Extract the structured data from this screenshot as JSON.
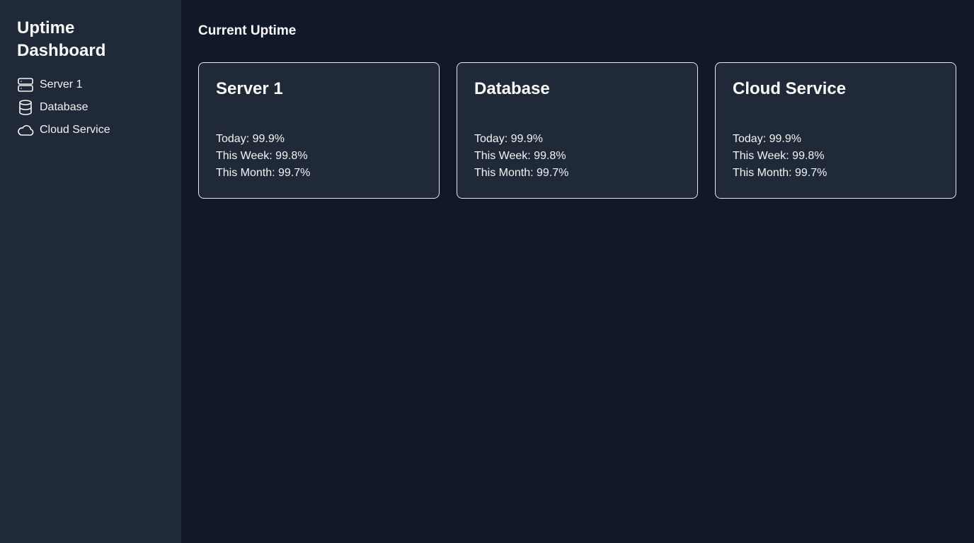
{
  "sidebar": {
    "title_line1": "Uptime",
    "title_line2": "Dashboard",
    "items": [
      {
        "label": "Server 1",
        "icon": "server-icon"
      },
      {
        "label": "Database",
        "icon": "database-icon"
      },
      {
        "label": "Cloud Service",
        "icon": "cloud-icon"
      }
    ]
  },
  "main": {
    "section_title": "Current Uptime",
    "cards": [
      {
        "title": "Server 1",
        "today": "Today: 99.9%",
        "week": "This Week: 99.8%",
        "month": "This Month: 99.7%"
      },
      {
        "title": "Database",
        "today": "Today: 99.9%",
        "week": "This Week: 99.8%",
        "month": "This Month: 99.7%"
      },
      {
        "title": "Cloud Service",
        "today": "Today: 99.9%",
        "week": "This Week: 99.8%",
        "month": "This Month: 99.7%"
      }
    ]
  },
  "colors": {
    "background": "#111827",
    "panel": "#1f2937",
    "text": "#f3f4f6",
    "card_border": "#e5e7eb"
  }
}
